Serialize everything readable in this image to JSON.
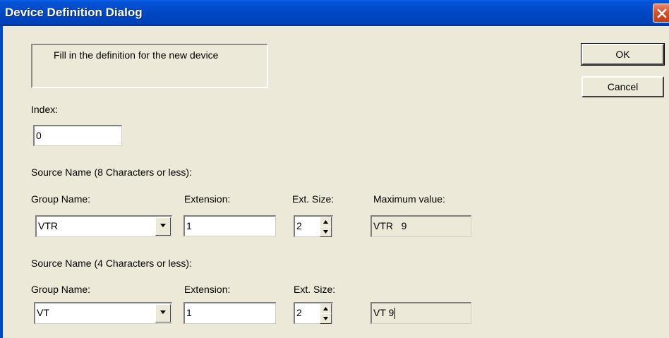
{
  "window": {
    "title": "Device Definition Dialog"
  },
  "message": "Fill in the definition for the new device",
  "buttons": {
    "ok": "OK",
    "cancel": "Cancel"
  },
  "index": {
    "label": "Index:",
    "value": "0"
  },
  "section1": {
    "heading": "Source Name (8 Characters or less):",
    "group_label": "Group Name:",
    "group_value": "VTR",
    "extension_label": "Extension:",
    "extension_value": "1",
    "ext_size_label": "Ext. Size:",
    "ext_size_value": "2",
    "max_label": "Maximum value:",
    "max_value": "VTR   9"
  },
  "section2": {
    "heading": "Source Name (4 Characters or less):",
    "group_label": "Group Name:",
    "group_value": "VT",
    "extension_label": "Extension:",
    "extension_value": "1",
    "ext_size_label": "Ext. Size:",
    "ext_size_value": "2",
    "max_value": "VT 9"
  },
  "icons": {
    "close": "close-icon",
    "dropdown": "chevron-down-icon",
    "spin_up": "spin-up-icon",
    "spin_down": "spin-down-icon"
  },
  "colors": {
    "titlebar": "#0047c4",
    "close_button": "#d4542f",
    "dialog_background": "#ece9d8"
  }
}
